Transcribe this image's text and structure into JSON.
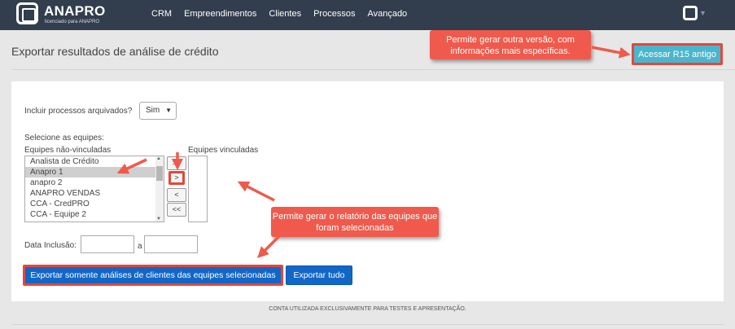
{
  "brand": {
    "name": "ANAPRO",
    "tagline": "licenciado para ANAPRO"
  },
  "nav": {
    "items": [
      "CRM",
      "Empreendimentos",
      "Clientes",
      "Processos",
      "Avançado"
    ]
  },
  "header": {
    "title": "Exportar resultados de análise de crédito",
    "r15_button_label": "Acessar R15 antigo"
  },
  "callouts": {
    "top_text": "Permite gerar outra versão, com informações mais específicas.",
    "bottom_text": "Permite gerar o relatório das equipes que foram selecionadas"
  },
  "form": {
    "archived_label": "Incluir processos arquivados?",
    "archived_value": "Sim",
    "teams_label": "Selecione as equipes:",
    "unlinked_label": "Equipes não-vinculadas",
    "linked_label": "Equipes vinculadas",
    "unlinked_teams": [
      {
        "label": "Analista de Crédito",
        "selected": false
      },
      {
        "label": "Anapro 1",
        "selected": true
      },
      {
        "label": "anapro 2",
        "selected": false
      },
      {
        "label": "ANAPRO VENDAS",
        "selected": false
      },
      {
        "label": "CCA - CredPRO",
        "selected": false
      },
      {
        "label": "CCA - Equipe 2",
        "selected": false
      }
    ],
    "move_all_right": ">>",
    "move_right": ">",
    "move_left": "<",
    "move_all_left": "<<",
    "date_label": "Data Inclusão:",
    "date_separator": "a",
    "date_from": "",
    "date_to": "",
    "export_selected_label": "Exportar somente análises de clientes das equipes selecionadas",
    "export_all_label": "Exportar tudo"
  },
  "footer": {
    "note": "CONTA UTILIZADA EXCLUSIVAMENTE PARA TESTES E APRESENTAÇÃO."
  },
  "colors": {
    "navbar": "#323d4d",
    "callout": "#ef5a4c",
    "highlight_border": "#e4473a",
    "primary_button": "#1267c6",
    "info_button": "#4ab6ce"
  }
}
